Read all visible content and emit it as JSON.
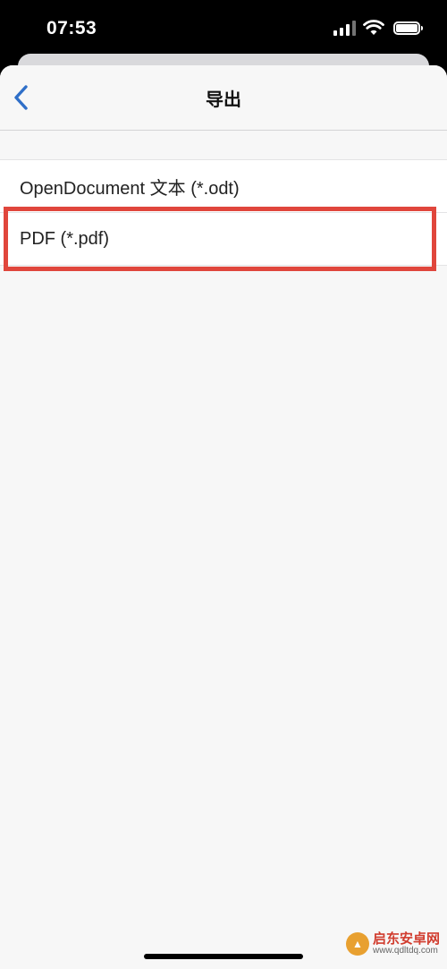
{
  "status_bar": {
    "time": "07:53",
    "icons": [
      "signal-icon",
      "wifi-icon",
      "battery-icon"
    ]
  },
  "nav": {
    "title": "导出",
    "back_icon": "chevron-left-icon"
  },
  "list": {
    "items": [
      {
        "label": "OpenDocument 文本 (*.odt)"
      },
      {
        "label": "PDF (*.pdf)"
      }
    ]
  },
  "highlight": {
    "color": "#e0463c",
    "target": "PDF (*.pdf)"
  },
  "watermark": {
    "text": "启东安卓网",
    "url": "www.qdltdq.com"
  },
  "colors": {
    "accent": "#2f6fc8",
    "highlight": "#e0463c"
  }
}
